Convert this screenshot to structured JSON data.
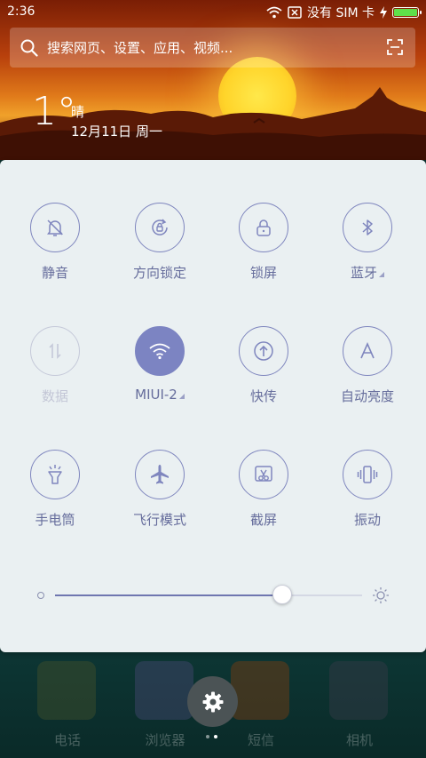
{
  "status_bar": {
    "time": "2:36",
    "carrier": "没有 SIM 卡",
    "battery_level": 1.0
  },
  "search": {
    "placeholder": "搜索网页、设置、应用、视频..."
  },
  "weather": {
    "temperature": "1°",
    "condition": "晴",
    "date": "12月11日 周一"
  },
  "toggles": [
    {
      "label": "静音",
      "icon": "bell-off-icon",
      "state": "off"
    },
    {
      "label": "方向锁定",
      "icon": "rotation-lock-icon",
      "state": "off"
    },
    {
      "label": "锁屏",
      "icon": "lock-icon",
      "state": "off"
    },
    {
      "label": "蓝牙",
      "icon": "bluetooth-icon",
      "state": "off",
      "has_menu": true
    },
    {
      "label": "数据",
      "icon": "mobile-data-icon",
      "state": "disabled"
    },
    {
      "label": "MIUI-2",
      "icon": "wifi-icon",
      "state": "on",
      "has_menu": true
    },
    {
      "label": "快传",
      "icon": "fast-transfer-icon",
      "state": "off"
    },
    {
      "label": "自动亮度",
      "icon": "auto-brightness-icon",
      "state": "off"
    },
    {
      "label": "手电筒",
      "icon": "flashlight-icon",
      "state": "off"
    },
    {
      "label": "飞行模式",
      "icon": "airplane-icon",
      "state": "off"
    },
    {
      "label": "截屏",
      "icon": "screenshot-icon",
      "state": "off"
    },
    {
      "label": "振动",
      "icon": "vibrate-icon",
      "state": "off"
    }
  ],
  "brightness": {
    "level": 0.74
  },
  "dock": [
    {
      "label": "电话",
      "icon": "phone-app-icon"
    },
    {
      "label": "浏览器",
      "icon": "browser-app-icon"
    },
    {
      "label": "短信",
      "icon": "messages-app-icon"
    },
    {
      "label": "相机",
      "icon": "camera-app-icon"
    }
  ],
  "colors": {
    "accent": "#7c84c2",
    "panel_bg": "#eaf0f2",
    "label": "#666d9c",
    "battery": "#5fe04a"
  }
}
